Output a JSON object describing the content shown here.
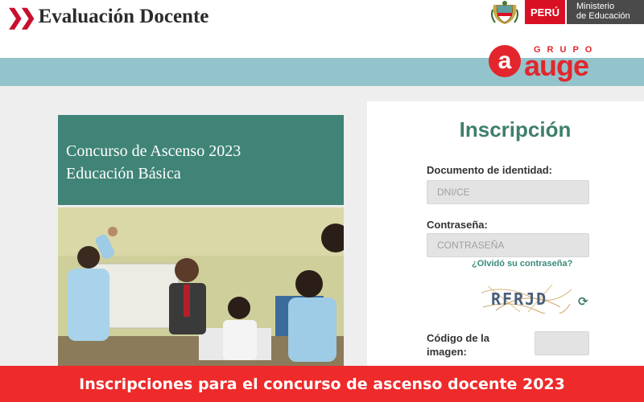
{
  "header": {
    "brand_title": "Evaluación Docente",
    "gov_flag_label": "PERÚ",
    "ministry_label_line1": "Ministerio",
    "ministry_label_line2": "de Educación"
  },
  "partner_logo": {
    "small_text": "GRUPO",
    "big_text": "auge",
    "circle_letter": "a"
  },
  "promo": {
    "title_line1": "Concurso de Ascenso 2023",
    "title_line2": "Educación Básica"
  },
  "form": {
    "title": "Inscripción",
    "document_label": "Documento de identidad:",
    "document_placeholder": "DNI/CE",
    "password_label": "Contraseña:",
    "password_placeholder": "CONTRASEÑA",
    "forgot_link": "¿Olvidó su contraseña?",
    "captcha_text": "RFRJD",
    "code_label": "Código de la imagen:"
  },
  "banner": {
    "text": "Inscripciones para el concurso de ascenso docente 2023"
  },
  "colors": {
    "accent_red": "#ee2a2a",
    "teal_band": "#93c3cb",
    "promo_green": "#3f8477",
    "form_title_green": "#3e7f6c"
  },
  "icons": [
    "chevron-right-icon",
    "coat-of-arms-icon",
    "refresh-icon"
  ]
}
